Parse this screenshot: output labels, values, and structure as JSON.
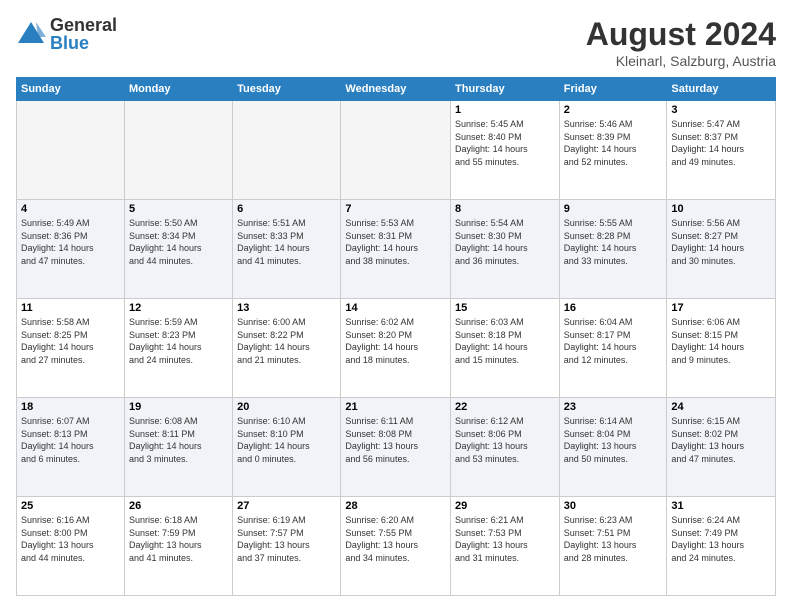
{
  "logo": {
    "general": "General",
    "blue": "Blue"
  },
  "title": {
    "month_year": "August 2024",
    "location": "Kleinarl, Salzburg, Austria"
  },
  "weekdays": [
    "Sunday",
    "Monday",
    "Tuesday",
    "Wednesday",
    "Thursday",
    "Friday",
    "Saturday"
  ],
  "weeks": [
    [
      {
        "day": "",
        "info": ""
      },
      {
        "day": "",
        "info": ""
      },
      {
        "day": "",
        "info": ""
      },
      {
        "day": "",
        "info": ""
      },
      {
        "day": "1",
        "info": "Sunrise: 5:45 AM\nSunset: 8:40 PM\nDaylight: 14 hours\nand 55 minutes."
      },
      {
        "day": "2",
        "info": "Sunrise: 5:46 AM\nSunset: 8:39 PM\nDaylight: 14 hours\nand 52 minutes."
      },
      {
        "day": "3",
        "info": "Sunrise: 5:47 AM\nSunset: 8:37 PM\nDaylight: 14 hours\nand 49 minutes."
      }
    ],
    [
      {
        "day": "4",
        "info": "Sunrise: 5:49 AM\nSunset: 8:36 PM\nDaylight: 14 hours\nand 47 minutes."
      },
      {
        "day": "5",
        "info": "Sunrise: 5:50 AM\nSunset: 8:34 PM\nDaylight: 14 hours\nand 44 minutes."
      },
      {
        "day": "6",
        "info": "Sunrise: 5:51 AM\nSunset: 8:33 PM\nDaylight: 14 hours\nand 41 minutes."
      },
      {
        "day": "7",
        "info": "Sunrise: 5:53 AM\nSunset: 8:31 PM\nDaylight: 14 hours\nand 38 minutes."
      },
      {
        "day": "8",
        "info": "Sunrise: 5:54 AM\nSunset: 8:30 PM\nDaylight: 14 hours\nand 36 minutes."
      },
      {
        "day": "9",
        "info": "Sunrise: 5:55 AM\nSunset: 8:28 PM\nDaylight: 14 hours\nand 33 minutes."
      },
      {
        "day": "10",
        "info": "Sunrise: 5:56 AM\nSunset: 8:27 PM\nDaylight: 14 hours\nand 30 minutes."
      }
    ],
    [
      {
        "day": "11",
        "info": "Sunrise: 5:58 AM\nSunset: 8:25 PM\nDaylight: 14 hours\nand 27 minutes."
      },
      {
        "day": "12",
        "info": "Sunrise: 5:59 AM\nSunset: 8:23 PM\nDaylight: 14 hours\nand 24 minutes."
      },
      {
        "day": "13",
        "info": "Sunrise: 6:00 AM\nSunset: 8:22 PM\nDaylight: 14 hours\nand 21 minutes."
      },
      {
        "day": "14",
        "info": "Sunrise: 6:02 AM\nSunset: 8:20 PM\nDaylight: 14 hours\nand 18 minutes."
      },
      {
        "day": "15",
        "info": "Sunrise: 6:03 AM\nSunset: 8:18 PM\nDaylight: 14 hours\nand 15 minutes."
      },
      {
        "day": "16",
        "info": "Sunrise: 6:04 AM\nSunset: 8:17 PM\nDaylight: 14 hours\nand 12 minutes."
      },
      {
        "day": "17",
        "info": "Sunrise: 6:06 AM\nSunset: 8:15 PM\nDaylight: 14 hours\nand 9 minutes."
      }
    ],
    [
      {
        "day": "18",
        "info": "Sunrise: 6:07 AM\nSunset: 8:13 PM\nDaylight: 14 hours\nand 6 minutes."
      },
      {
        "day": "19",
        "info": "Sunrise: 6:08 AM\nSunset: 8:11 PM\nDaylight: 14 hours\nand 3 minutes."
      },
      {
        "day": "20",
        "info": "Sunrise: 6:10 AM\nSunset: 8:10 PM\nDaylight: 14 hours\nand 0 minutes."
      },
      {
        "day": "21",
        "info": "Sunrise: 6:11 AM\nSunset: 8:08 PM\nDaylight: 13 hours\nand 56 minutes."
      },
      {
        "day": "22",
        "info": "Sunrise: 6:12 AM\nSunset: 8:06 PM\nDaylight: 13 hours\nand 53 minutes."
      },
      {
        "day": "23",
        "info": "Sunrise: 6:14 AM\nSunset: 8:04 PM\nDaylight: 13 hours\nand 50 minutes."
      },
      {
        "day": "24",
        "info": "Sunrise: 6:15 AM\nSunset: 8:02 PM\nDaylight: 13 hours\nand 47 minutes."
      }
    ],
    [
      {
        "day": "25",
        "info": "Sunrise: 6:16 AM\nSunset: 8:00 PM\nDaylight: 13 hours\nand 44 minutes."
      },
      {
        "day": "26",
        "info": "Sunrise: 6:18 AM\nSunset: 7:59 PM\nDaylight: 13 hours\nand 41 minutes."
      },
      {
        "day": "27",
        "info": "Sunrise: 6:19 AM\nSunset: 7:57 PM\nDaylight: 13 hours\nand 37 minutes."
      },
      {
        "day": "28",
        "info": "Sunrise: 6:20 AM\nSunset: 7:55 PM\nDaylight: 13 hours\nand 34 minutes."
      },
      {
        "day": "29",
        "info": "Sunrise: 6:21 AM\nSunset: 7:53 PM\nDaylight: 13 hours\nand 31 minutes."
      },
      {
        "day": "30",
        "info": "Sunrise: 6:23 AM\nSunset: 7:51 PM\nDaylight: 13 hours\nand 28 minutes."
      },
      {
        "day": "31",
        "info": "Sunrise: 6:24 AM\nSunset: 7:49 PM\nDaylight: 13 hours\nand 24 minutes."
      }
    ]
  ]
}
